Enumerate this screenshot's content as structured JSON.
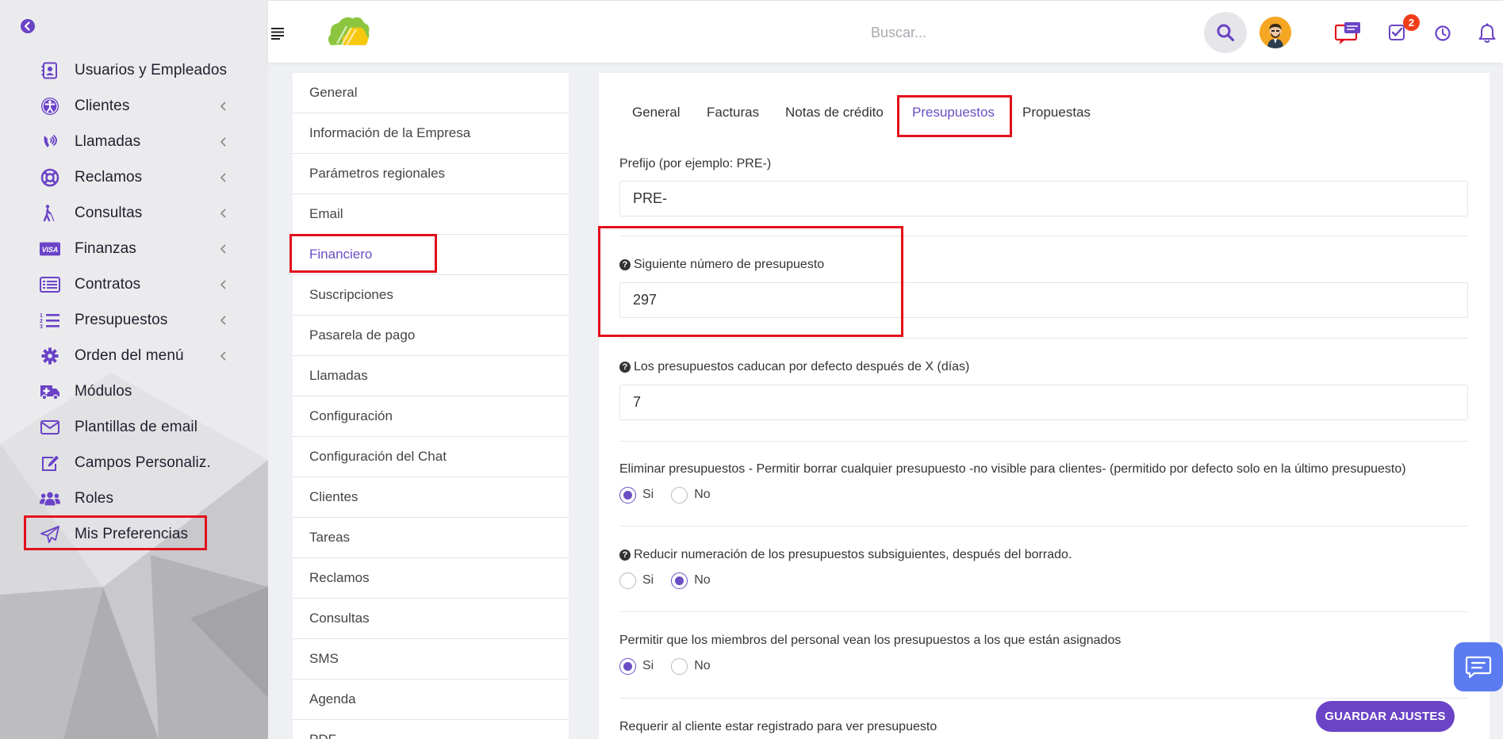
{
  "search": {
    "placeholder": "Buscar..."
  },
  "notifications": {
    "tasks_badge": "2"
  },
  "sidebar": {
    "items": [
      {
        "label": "Usuarios y Empleados",
        "icon": "user-card-icon",
        "has_chevron": false
      },
      {
        "label": "Clientes",
        "icon": "universal-access-icon",
        "has_chevron": true
      },
      {
        "label": "Llamadas",
        "icon": "phone-volume-icon",
        "has_chevron": true
      },
      {
        "label": "Reclamos",
        "icon": "life-ring-icon",
        "has_chevron": true
      },
      {
        "label": "Consultas",
        "icon": "blind-person-icon",
        "has_chevron": true
      },
      {
        "label": "Finanzas",
        "icon": "visa-card-icon",
        "has_chevron": true
      },
      {
        "label": "Contratos",
        "icon": "list-alt-icon",
        "has_chevron": true
      },
      {
        "label": "Presupuestos",
        "icon": "list-ol-icon",
        "has_chevron": true
      },
      {
        "label": "Orden del menú",
        "icon": "gear-icon",
        "has_chevron": true
      },
      {
        "label": "Módulos",
        "icon": "ambulance-icon",
        "has_chevron": false
      },
      {
        "label": "Plantillas de email",
        "icon": "envelope-icon",
        "has_chevron": false
      },
      {
        "label": "Campos Personaliz.",
        "icon": "edit-icon",
        "has_chevron": false
      },
      {
        "label": "Roles",
        "icon": "users-icon",
        "has_chevron": false
      },
      {
        "label": "Mis Preferencias",
        "icon": "paper-plane-icon",
        "has_chevron": false
      }
    ]
  },
  "settings_nav": {
    "active": "Financiero",
    "items": [
      "General",
      "Información de la Empresa",
      "Parámetros regionales",
      "Email",
      "Financiero",
      "Suscripciones",
      "Pasarela de pago",
      "Llamadas",
      "Configuración",
      "Configuración del Chat",
      "Clientes",
      "Tareas",
      "Reclamos",
      "Consultas",
      "SMS",
      "Agenda",
      "PDF"
    ]
  },
  "tabs": {
    "active": "Presupuestos",
    "items": [
      "General",
      "Facturas",
      "Notas de crédito",
      "Presupuestos",
      "Propuestas"
    ]
  },
  "form": {
    "prefix": {
      "label": "Prefijo (por ejemplo: PRE-)",
      "value": "PRE-"
    },
    "next_number": {
      "label": "Siguiente número de presupuesto",
      "value": "297"
    },
    "expiry": {
      "label": "Los presupuestos caducan por defecto después de X (días)",
      "value": "7"
    },
    "delete_estimates": {
      "label": "Eliminar presupuestos - Permitir borrar cualquier presupuesto -no visible para clientes- (permitido por defecto solo en la último presupuesto)",
      "selected": "Si"
    },
    "reduce_numbering": {
      "label": "Reducir numeración de los presupuestos subsiguientes, después del borrado.",
      "selected": "No"
    },
    "staff_view_assigned": {
      "label": "Permitir que los miembros del personal vean los presupuestos a los que están asignados",
      "selected": "Si"
    },
    "require_login": {
      "label": "Requerir al cliente estar registrado para ver presupuesto"
    },
    "yes_label": "Si",
    "no_label": "No"
  },
  "save_button": "GUARDAR AJUSTES",
  "colors": {
    "accent": "#6a4ec4",
    "highlight_box": "#e2101b",
    "badge": "#f03d18",
    "chat_fab": "#5b7bf0"
  }
}
